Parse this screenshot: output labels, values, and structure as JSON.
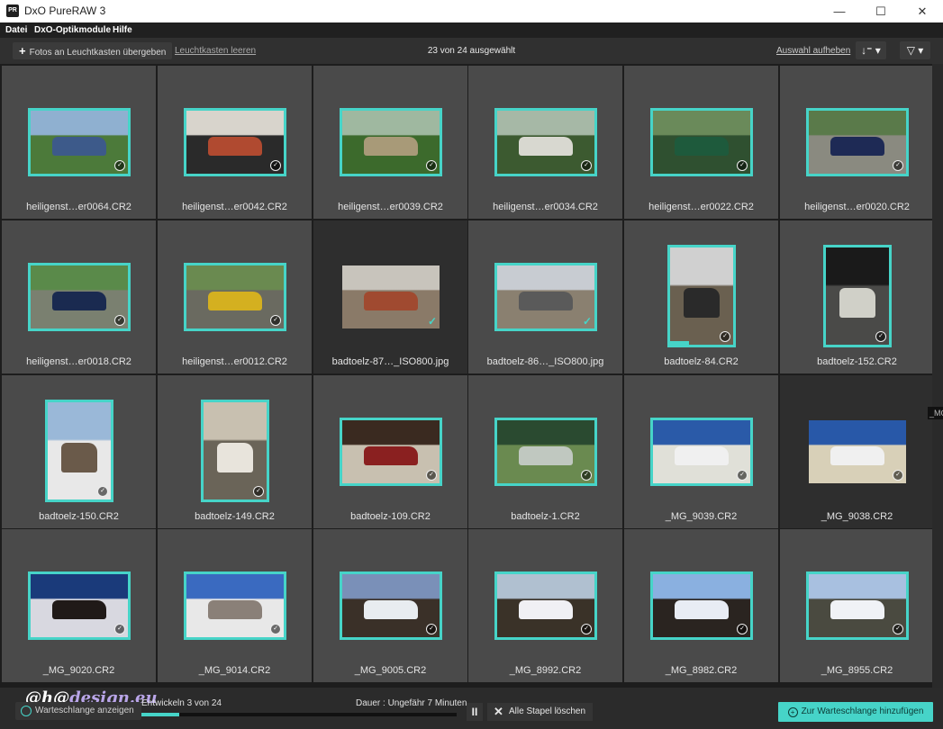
{
  "titlebar": {
    "logo_text": "PR",
    "title": "DxO PureRAW 3",
    "minimize": "—",
    "maximize": "☐",
    "close": "✕"
  },
  "menu": [
    "Datei",
    "DxO-Optikmodule",
    "Hilfe"
  ],
  "toolbar": {
    "add_label": "Fotos an Leuchtkasten übergeben",
    "clear_label": "Leuchtkasten leeren",
    "selection_count": "23 von 24 ausgewählt",
    "deselect_label": "Auswahl aufheben",
    "sort_icon": "↓⁼ ▾",
    "filter_icon": "▽ ▾"
  },
  "photos": [
    {
      "name": "heiligenst…er0064.CR2",
      "selected": true,
      "scene": "car-blue",
      "orientation": "landscape"
    },
    {
      "name": "heiligenst…er0042.CR2",
      "selected": true,
      "scene": "car-interior",
      "orientation": "landscape"
    },
    {
      "name": "heiligenst…er0039.CR2",
      "selected": true,
      "scene": "car-beige",
      "orientation": "landscape"
    },
    {
      "name": "heiligenst…er0034.CR2",
      "selected": true,
      "scene": "van-white",
      "orientation": "landscape"
    },
    {
      "name": "heiligenst…er0022.CR2",
      "selected": true,
      "scene": "van-green",
      "orientation": "landscape"
    },
    {
      "name": "heiligenst…er0020.CR2",
      "selected": true,
      "scene": "car-navy",
      "orientation": "landscape"
    },
    {
      "name": "heiligenst…er0018.CR2",
      "selected": true,
      "scene": "car-navy2",
      "orientation": "landscape"
    },
    {
      "name": "heiligenst…er0012.CR2",
      "selected": true,
      "scene": "car-yellow",
      "orientation": "landscape"
    },
    {
      "name": "badtoelz-87…_ISO800.jpg",
      "selected": false,
      "scene": "building-facade",
      "orientation": "landscape",
      "tick": true
    },
    {
      "name": "badtoelz-86…_ISO800.jpg",
      "selected": true,
      "scene": "street",
      "orientation": "landscape",
      "tick": true
    },
    {
      "name": "badtoelz-84.CR2",
      "selected": true,
      "scene": "alley",
      "orientation": "portrait",
      "progress": 0.3
    },
    {
      "name": "badtoelz-152.CR2",
      "selected": true,
      "scene": "arcade-dark",
      "orientation": "portrait"
    },
    {
      "name": "badtoelz-150.CR2",
      "selected": true,
      "scene": "house-white",
      "orientation": "portrait"
    },
    {
      "name": "badtoelz-149.CR2",
      "selected": true,
      "scene": "corridor",
      "orientation": "portrait"
    },
    {
      "name": "badtoelz-109.CR2",
      "selected": true,
      "scene": "tunnel-shop",
      "orientation": "landscape"
    },
    {
      "name": "badtoelz-1.CR2",
      "selected": true,
      "scene": "hillside",
      "orientation": "landscape"
    },
    {
      "name": "_MG_9039.CR2",
      "selected": true,
      "scene": "modern-blue",
      "orientation": "landscape"
    },
    {
      "name": "_MG_9038.CR2",
      "selected": true,
      "scene": "modern-blue2",
      "orientation": "landscape",
      "dark": true
    },
    {
      "name": "_MG_9020.CR2",
      "selected": true,
      "scene": "smoke",
      "orientation": "landscape"
    },
    {
      "name": "_MG_9014.CR2",
      "selected": true,
      "scene": "white-building",
      "orientation": "landscape"
    },
    {
      "name": "_MG_9005.CR2",
      "selected": true,
      "scene": "winter-river",
      "orientation": "landscape"
    },
    {
      "name": "_MG_8992.CR2",
      "selected": true,
      "scene": "winter-creek",
      "orientation": "landscape"
    },
    {
      "name": "_MG_8982.CR2",
      "selected": true,
      "scene": "winter-sun",
      "orientation": "landscape"
    },
    {
      "name": "_MG_8955.CR2",
      "selected": true,
      "scene": "winter-trees",
      "orientation": "landscape"
    }
  ],
  "scroll_tip": "_MG",
  "bottom": {
    "watermark_a": "@h@",
    "watermark_b": "design.eu",
    "queue_label": "Warteschlange anzeigen",
    "develop_label": "Entwickeln 3 von 24",
    "duration_label": "Dauer : Ungefähr 7 Minuten",
    "progress": 0.12,
    "pause_icon": "II",
    "clear_stacks_label": "Alle Stapel löschen",
    "clear_icon": "✕",
    "add_queue_label": "Zur Warteschlange hinzufügen",
    "add_queue_icon": "+"
  },
  "colors": {
    "accent": "#46d4c8",
    "cell_bg": "#4a4a4a",
    "cell_unselected": "#2e2e2e"
  }
}
